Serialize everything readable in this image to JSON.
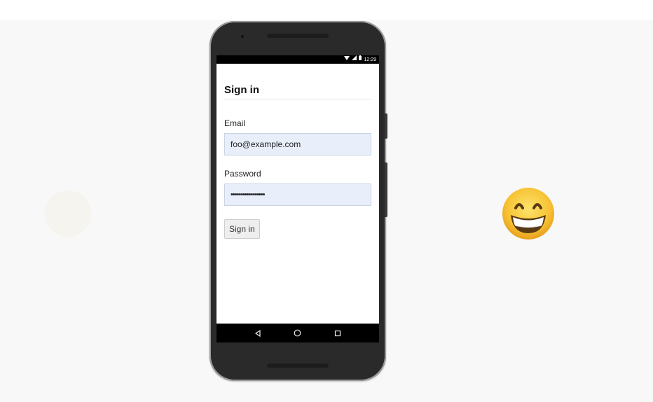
{
  "status_bar": {
    "time": "12:29",
    "icons": [
      "wifi-icon",
      "signal-icon",
      "battery-icon"
    ]
  },
  "form": {
    "title": "Sign in",
    "email_label": "Email",
    "email_value": "foo@example.com",
    "password_label": "Password",
    "password_value": "•••••••••••••••••",
    "submit_label": "Sign in"
  },
  "nav_bar": {
    "icons": [
      "back-icon",
      "home-icon",
      "recents-icon"
    ]
  },
  "decorations": {
    "emoji": "grinning-face-icon"
  },
  "colors": {
    "field_background": "#e8eefa",
    "phone_body": "#2a2a2a",
    "emoji_yellow": "#f7c233"
  }
}
